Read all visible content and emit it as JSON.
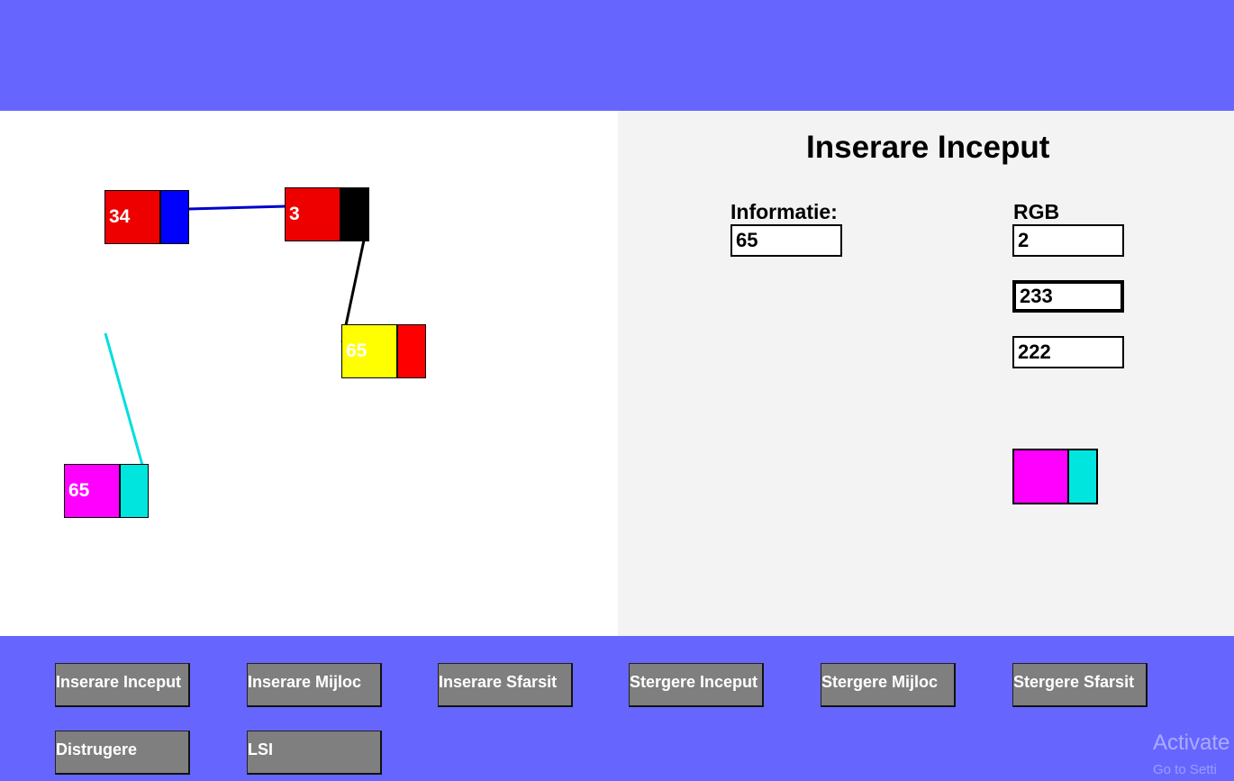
{
  "colors": {
    "bar": "#6666ff",
    "panel": "#f3f3f3",
    "button": "#7f7f7f"
  },
  "nodes": [
    {
      "value": "34",
      "info_color": "#ee0000",
      "ptr_color": "#0000ff"
    },
    {
      "value": "3",
      "info_color": "#ee0000",
      "ptr_color": "#000000"
    },
    {
      "value": "65",
      "info_color": "#ffff00",
      "ptr_color": "#ff0000"
    },
    {
      "value": "65",
      "info_color": "#ff00ff",
      "ptr_color": "#00e5de"
    }
  ],
  "panel": {
    "title": "Inserare Inceput",
    "info_label": "Informatie:",
    "info_value": "65",
    "rgb_label": "RGB",
    "r_value": "2",
    "g_value": "233",
    "b_value": "222",
    "preview_colors": {
      "info": "#ff00ff",
      "ptr": "#00e5de"
    }
  },
  "buttons": {
    "insert_start": "Inserare Inceput",
    "insert_middle": "Inserare Mijloc",
    "insert_end": "Inserare Sfarsit",
    "delete_start": "Stergere Inceput",
    "delete_middle": "Stergere Mijloc",
    "delete_end": "Stergere Sfarsit",
    "destroy": "Distrugere",
    "lsi": "LSI"
  },
  "watermark": {
    "line1": "Activate",
    "line2": "Go to Setti"
  }
}
